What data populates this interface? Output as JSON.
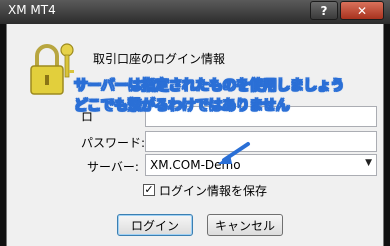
{
  "window": {
    "title": "XM MT4",
    "help_label": "?",
    "close_label": "✕"
  },
  "dialog": {
    "section_title": "取引口座のログイン情報",
    "login_label": "ロ",
    "password_label": "パスワード:",
    "server_label": "サーバー:",
    "server_value": "XM.COM-Demo",
    "remember_label": "ログイン情報を保存",
    "remember_checked": true,
    "login_button": "ログイン",
    "cancel_button": "キャンセル"
  },
  "annotation": {
    "line1": "サーバーは指定されたものを使用しましょう",
    "line2": "どこでも繋がるわけではありません"
  },
  "colors": {
    "annotation_accent": "#2a6fd6"
  }
}
